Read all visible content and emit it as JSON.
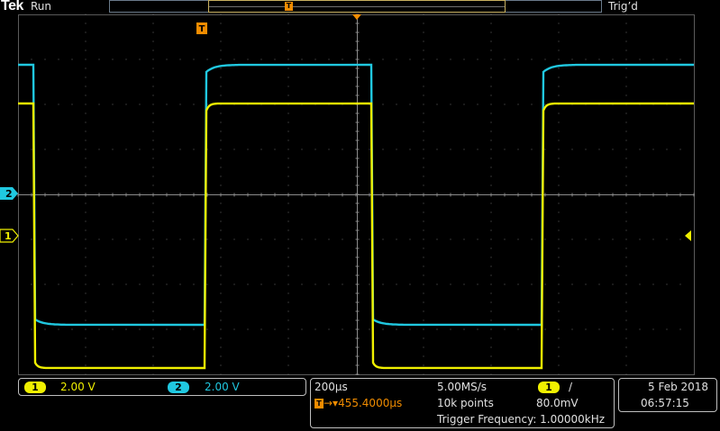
{
  "header": {
    "brand": "Tek",
    "acq_state": "Run",
    "trigger_state": "Trig’d",
    "trigger_marker": "T"
  },
  "markers": {
    "ch2_label": "2",
    "ch1_label": "1"
  },
  "channels": [
    {
      "id": "1",
      "scale": "2.00 V",
      "color": "#f0f000"
    },
    {
      "id": "2",
      "scale": "2.00 V",
      "color": "#20c8e0"
    }
  ],
  "horizontal": {
    "time_per_div": "200µs",
    "sample_rate": "5.00MS/s",
    "trigger_delay": "455.4000µs",
    "record_length": "10k points",
    "trigger_source": "1",
    "trigger_slope": "/",
    "trigger_level": "80.0mV",
    "trigger_frequency": "Trigger Frequency: 1.00000kHz"
  },
  "datetime": {
    "date": "5 Feb  2018",
    "time": "06:57:15"
  },
  "colors": {
    "ch1": "#f0f000",
    "ch2": "#20c8e0",
    "trigger": "#f08c00",
    "graticule": "#707070"
  }
}
